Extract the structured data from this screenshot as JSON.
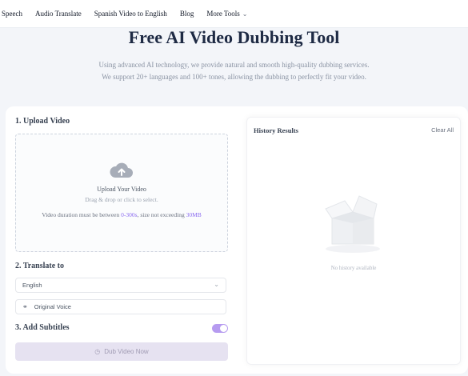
{
  "nav": {
    "items": [
      "Speech",
      "Audio Translate",
      "Spanish Video to English",
      "Blog",
      "More Tools"
    ]
  },
  "hero": {
    "title": "Free AI Video Dubbing Tool",
    "subtitle_line1": "Using advanced AI technology, we provide natural and smooth high-quality dubbing services.",
    "subtitle_line2": "We support 20+ languages and 100+ tones, allowing the dubbing to perfectly fit your video."
  },
  "upload": {
    "section_title": "1. Upload Video",
    "title": "Upload Your Video",
    "hint": "Drag & drop or click to select.",
    "limit_prefix": "Video duration must be between ",
    "limit_duration": "0-300s",
    "limit_middle": ", size not exceeding ",
    "limit_size": "30MB"
  },
  "translate": {
    "section_title": "2. Translate to",
    "language_value": "English",
    "voice_value": "Original Voice"
  },
  "subtitles": {
    "section_title": "3. Add Subtitles",
    "enabled": true
  },
  "actions": {
    "dub_label": "Dub Video Now"
  },
  "history": {
    "title": "History Results",
    "clear_label": "Clear All",
    "empty_text": "No history available"
  },
  "colors": {
    "accent": "#8b6cf0",
    "toggle": "#b69bf0",
    "dub_button_bg": "#e6e2f1",
    "title": "#1e2a44",
    "page_bg": "#f3f5f9"
  },
  "icons": {
    "upload": "cloud-upload-icon",
    "dropdown": "chevron-down-icon",
    "voice": "headphones-icon",
    "dub": "clock-icon",
    "empty": "empty-box-icon"
  }
}
